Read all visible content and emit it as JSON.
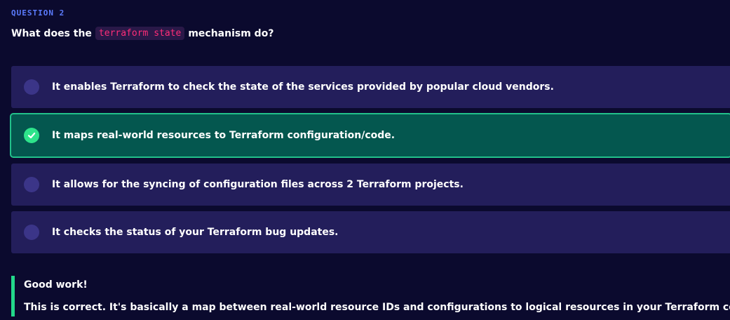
{
  "question": {
    "label": "QUESTION 2",
    "text_before": "What does the",
    "code": "terraform state",
    "text_after": "mechanism do?"
  },
  "options": [
    {
      "text": "It enables Terraform to check the state of the services provided by popular cloud vendors.",
      "selected": false,
      "correct": false
    },
    {
      "text": "It maps real-world resources to Terraform configuration/code.",
      "selected": true,
      "correct": true
    },
    {
      "text": "It allows for the syncing of configuration files across 2 Terraform projects.",
      "selected": false,
      "correct": false
    },
    {
      "text": "It checks the status of your Terraform bug updates.",
      "selected": false,
      "correct": false
    }
  ],
  "feedback": {
    "title": "Good work!",
    "body": "This is correct. It's basically a map between real-world resource IDs and configurations to logical resources in your Terraform code."
  },
  "colors": {
    "background": "#0b0a2e",
    "option_bg": "#231e5b",
    "correct_bg": "#04574f",
    "correct_border": "#22c08a",
    "accent_label": "#5c7cff",
    "code_text": "#ff2d78",
    "feedback_bar": "#22d88a"
  },
  "icons": {
    "correct": "check-circle-icon",
    "unselected": "radio-empty-icon"
  }
}
